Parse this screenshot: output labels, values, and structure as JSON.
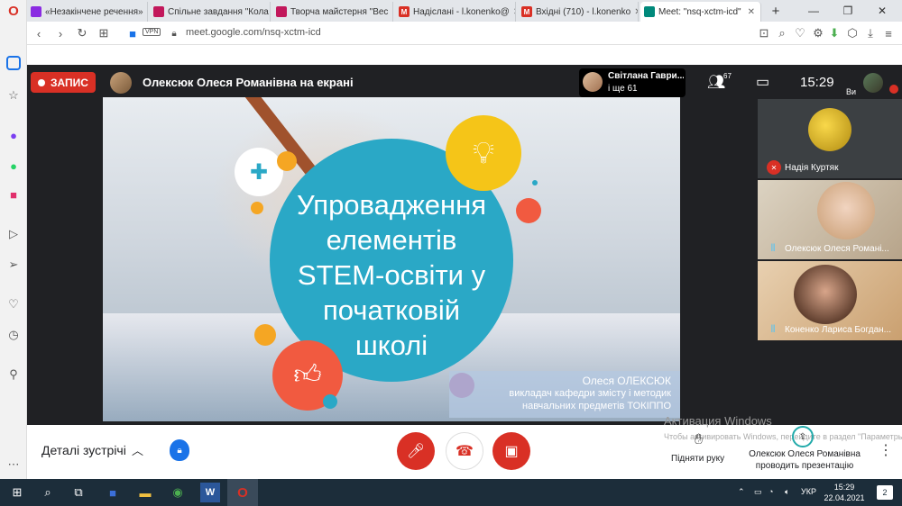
{
  "browser": {
    "tabs": [
      {
        "label": "«Незакінчене речення»",
        "icon_color": "#8a2be2"
      },
      {
        "label": "Спільне завдання \"Кола",
        "icon_color": "#c2185b"
      },
      {
        "label": "Творча майстерня \"Вес",
        "icon_color": "#c2185b"
      },
      {
        "label": "Надіслані - l.konenko@",
        "icon_color": "#d93025"
      },
      {
        "label": "Вхідні (710) - l.konenko",
        "icon_color": "#d93025"
      },
      {
        "label": "Meet: \"nsq-xctm-icd\"",
        "icon_color": "#00897b"
      }
    ],
    "url": "meet.google.com/nsq-xctm-icd",
    "vpn_label": "VPN"
  },
  "meet": {
    "recording_label": "ЗАПИС",
    "presenter_text": "Олексюк Олеся Романівна на екрані",
    "pinned": {
      "name": "Світлана Гаври...",
      "more": "і ще 61"
    },
    "participants_count": "67",
    "clock": "15:29",
    "self_label": "Ви"
  },
  "slide": {
    "title_lines": [
      "Упровадження",
      "елементів",
      "STEM-освіти у",
      "початковій",
      "школі"
    ],
    "author": "Олеся ОЛЕКСЮК",
    "role_line1": "викладач кафедри змісту і методик",
    "role_line2": "навчальних предметів ТОКІППО"
  },
  "tiles": [
    {
      "name": "Надія Куртяк",
      "mic": "muted"
    },
    {
      "name": "Олексюк Олеся Романі...",
      "mic": "speaking"
    },
    {
      "name": "Коненко Лариса Богдан...",
      "mic": "speaking"
    }
  ],
  "bottom": {
    "details_label": "Деталі зустрічі",
    "raise_hand_label": "Підняти руку",
    "presenting_line1": "Олексюк Олеся Романівна",
    "presenting_line2": "проводить презентацію",
    "windows_activation": "Активация Windows",
    "windows_activation_sub": "Чтобы активировать Windows, перейдите в раздел \"Параметры\"."
  },
  "taskbar": {
    "lang": "УКР",
    "time": "15:29",
    "date": "22.04.2021",
    "notifications": "2"
  },
  "colors": {
    "meet_bg": "#202124",
    "record_red": "#d93025",
    "slide_circle": "#2aa8c6",
    "taskbar_bg": "#1c2d3a"
  }
}
